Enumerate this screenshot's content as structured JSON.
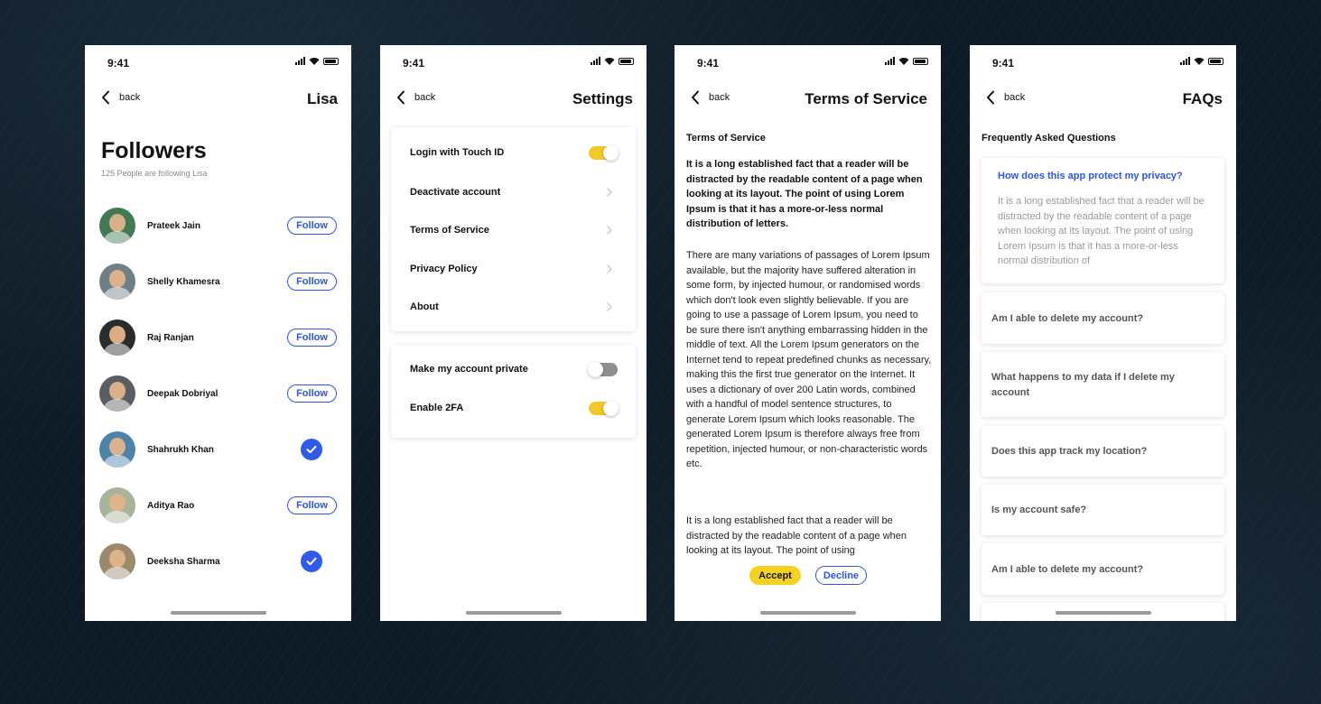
{
  "status_time": "9:41",
  "back_label": "back",
  "followers": {
    "nav_title": "Lisa",
    "title": "Followers",
    "subtitle": "125 People are following Lisa",
    "follow_label": "Follow",
    "people": [
      {
        "name": "Prateek Jain",
        "state": "follow",
        "color": "#3f7a54"
      },
      {
        "name": "Shelly Khamesra",
        "state": "follow",
        "color": "#6f7f86"
      },
      {
        "name": "Raj Ranjan",
        "state": "follow",
        "color": "#2b2b2b"
      },
      {
        "name": "Deepak Dobriyal",
        "state": "follow",
        "color": "#5a5e63"
      },
      {
        "name": "Shahrukh Khan",
        "state": "following",
        "color": "#4b84a8"
      },
      {
        "name": "Aditya Rao",
        "state": "follow",
        "color": "#a7b49a"
      },
      {
        "name": "Deeksha Sharma",
        "state": "following",
        "color": "#9c8a6c"
      }
    ]
  },
  "settings": {
    "nav_title": "Settings",
    "group1": [
      {
        "label": "Login with Touch ID",
        "control": "toggle",
        "on": true
      },
      {
        "label": "Deactivate account",
        "control": "chevron"
      },
      {
        "label": "Terms of Service",
        "control": "chevron"
      },
      {
        "label": "Privacy Policy",
        "control": "chevron"
      },
      {
        "label": "About",
        "control": "chevron"
      }
    ],
    "group2": [
      {
        "label": "Make my account private",
        "control": "toggle",
        "on": false
      },
      {
        "label": "Enable 2FA",
        "control": "toggle",
        "on": true
      }
    ]
  },
  "terms": {
    "nav_title": "Terms of Service",
    "heading": "Terms of Service",
    "lead": "It is a long established fact that a reader will be distracted by the readable content of a page when looking at its layout. The point of using Lorem Ipsum is that it has a more-or-less normal distribution of letters.",
    "body": "There are many variations of passages of Lorem Ipsum available, but the majority have suffered alteration in some form, by injected humour, or randomised words which don't look even slightly believable. If you are going to use a passage of Lorem Ipsum, you need to be sure there isn't anything embarrassing hidden in the middle of text. All the Lorem Ipsum generators on the Internet tend to repeat predefined chunks as necessary, making this the first true generator on the Internet. It uses a dictionary of over 200 Latin words, combined with a handful of model sentence structures, to generate Lorem Ipsum which looks reasonable. The generated Lorem Ipsum is therefore always free from repetition, injected humour, or non-characteristic words etc.",
    "body2": "It is a long established fact that a reader will be distracted by the readable content of a page when looking at its layout. The point of using",
    "accept_label": "Accept",
    "decline_label": "Decline"
  },
  "faqs": {
    "nav_title": "FAQs",
    "heading": "Frequently Asked Questions",
    "open_question": "How does this app protect my privacy?",
    "open_answer": "It is a long established fact that a reader will be distracted by the readable content of a page when looking at its layout. The point of using Lorem Ipsum is that it has a more-or-less normal distribution of",
    "questions": [
      "Am I able to delete my account?",
      "What happens to my data if I delete my account",
      "Does this app track my location?",
      "Is my account safe?",
      "Am I able to delete my account?"
    ]
  },
  "colors": {
    "accent_blue": "#2a57e6",
    "toggle_on": "#f3c928",
    "accept_yellow": "#f7d11f",
    "background": "#0e1b26"
  }
}
